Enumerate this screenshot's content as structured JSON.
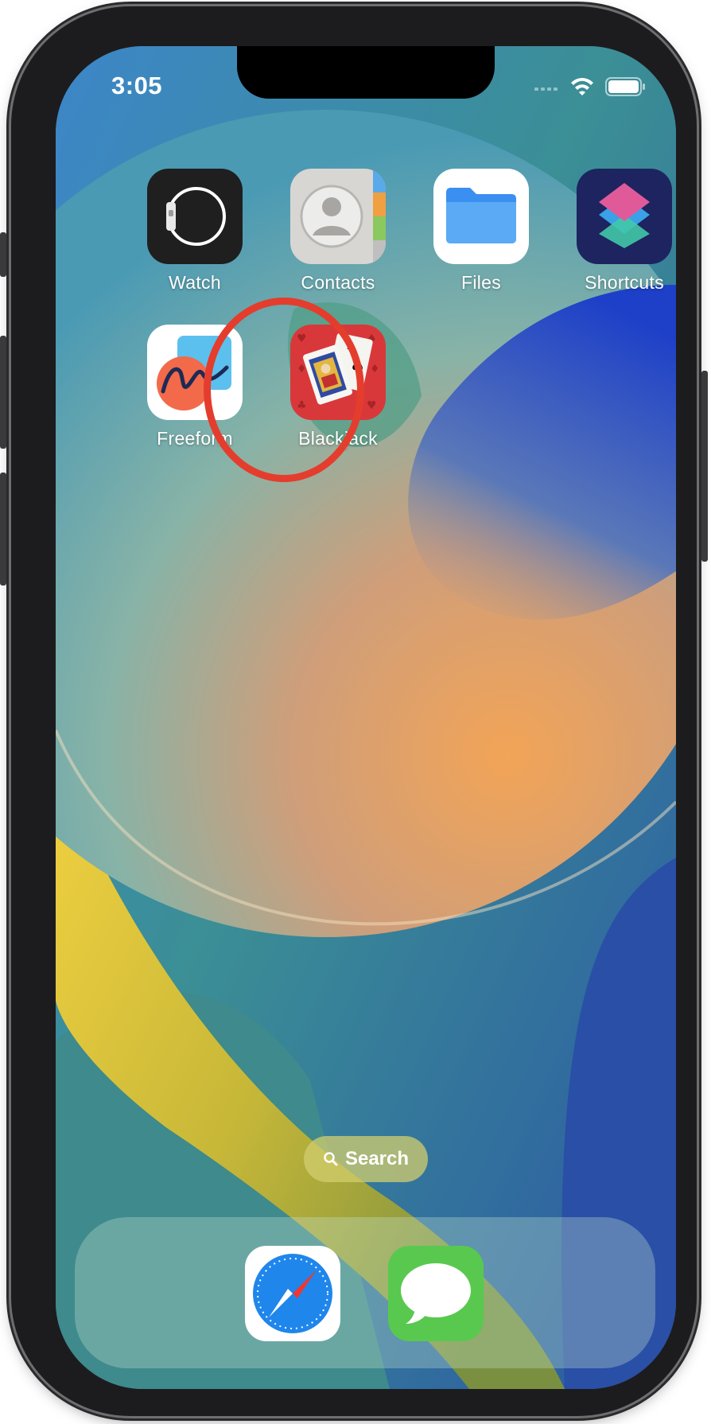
{
  "status_bar": {
    "time": "3:05",
    "icons": [
      "signal-icon",
      "wifi-icon",
      "battery-icon"
    ]
  },
  "home_apps": [
    {
      "label": "Watch",
      "icon": "watch-icon"
    },
    {
      "label": "Contacts",
      "icon": "contacts-icon"
    },
    {
      "label": "Files",
      "icon": "files-icon"
    },
    {
      "label": "Shortcuts",
      "icon": "shortcuts-icon"
    },
    {
      "label": "Freeform",
      "icon": "freeform-icon"
    },
    {
      "label": "Blackjack",
      "icon": "blackjack-icon"
    }
  ],
  "highlight": {
    "target": "Blackjack",
    "color": "#e43d2d"
  },
  "search": {
    "label": "Search"
  },
  "dock": [
    {
      "name": "Safari",
      "icon": "safari-icon"
    },
    {
      "name": "Messages",
      "icon": "messages-icon"
    }
  ]
}
